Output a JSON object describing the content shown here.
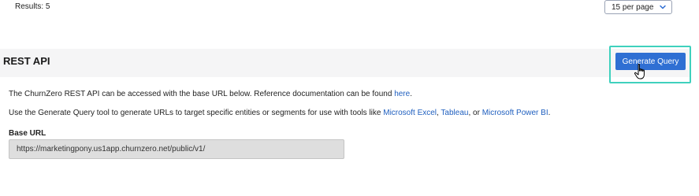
{
  "results": {
    "label": "Results: 5"
  },
  "pagination": {
    "per_page_selected": "15 per page"
  },
  "rest_api": {
    "title": "REST API",
    "generate_button": "Generate Query",
    "description_prefix": "The ChurnZero REST API can be accessed with the base URL below. Reference documentation can be found ",
    "doc_link": "here",
    "description_suffix": ".",
    "tool_text_prefix": "Use the Generate Query tool to generate URLs to target specific entities or segments for use with tools like ",
    "tool_link_excel": "Microsoft Excel",
    "sep1": ", ",
    "tool_link_tableau": "Tableau",
    "sep2": ", or ",
    "tool_link_powerbi": "Microsoft Power BI",
    "tool_text_suffix": ".",
    "base_url_label": "Base URL",
    "base_url_value": "https://marketingpony.us1app.churnzero.net/public/v1/"
  },
  "colors": {
    "accent_button": "#2f6fd3",
    "highlight_border": "#3fd1bd",
    "link": "#1f5fbf"
  },
  "icons": {
    "dropdown": "chevron-down-icon",
    "cursor": "hand-pointer-icon"
  }
}
